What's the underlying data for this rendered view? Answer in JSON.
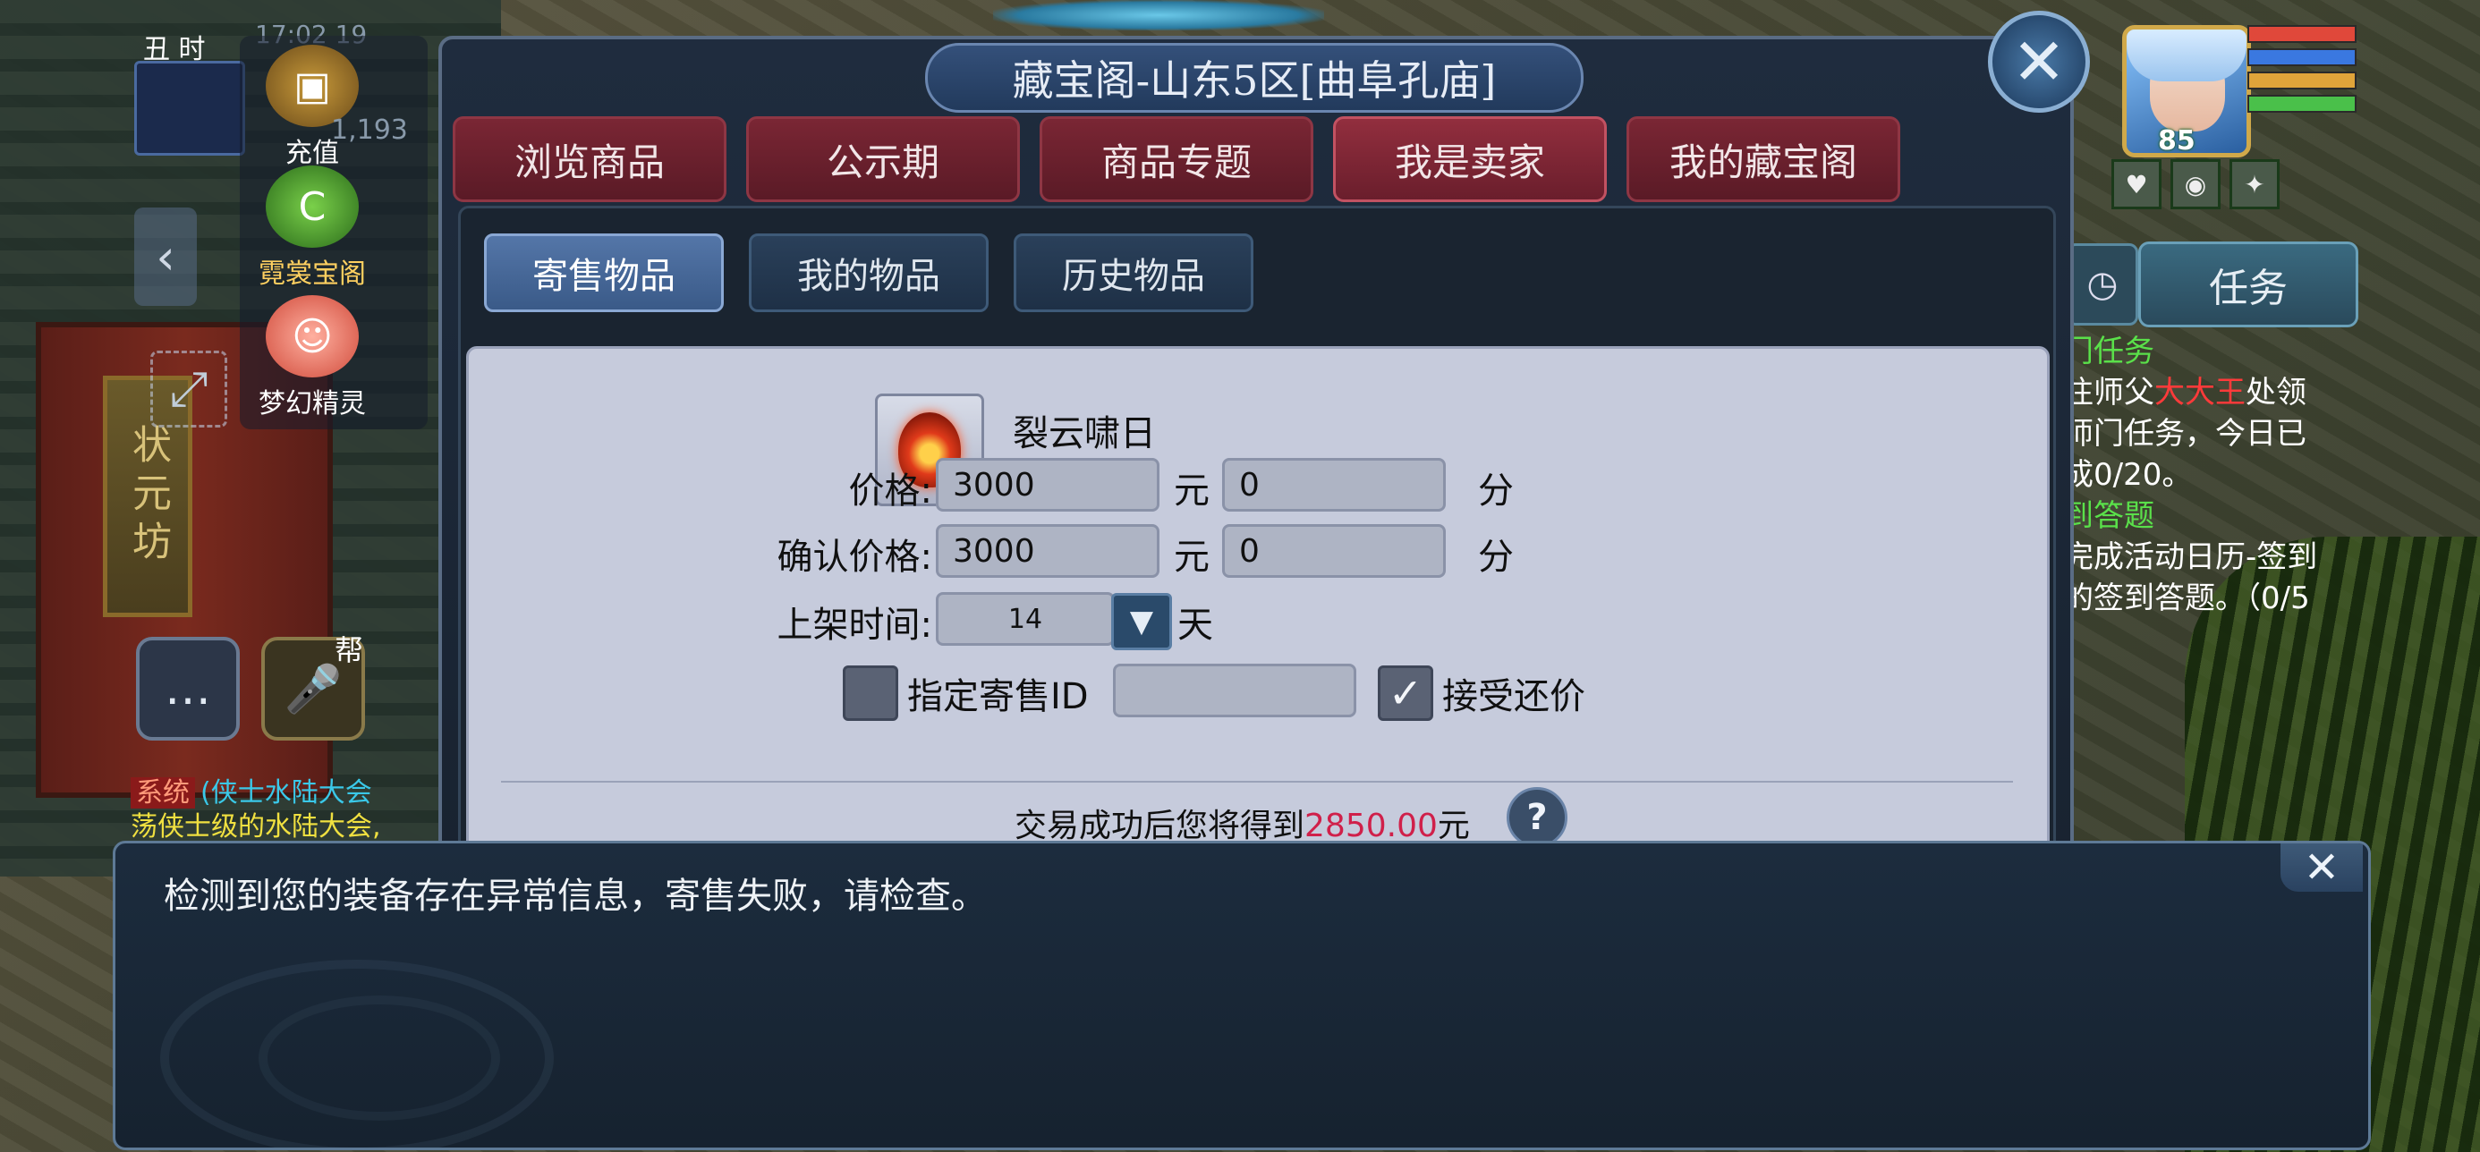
{
  "hud": {
    "time_label": "丑 时",
    "hud_info": "17:02 19",
    "hud_number": "1,193",
    "menu": [
      {
        "label": "充值"
      },
      {
        "label": "霓裳宝阁"
      },
      {
        "label": "梦幻精灵"
      }
    ],
    "bang_label": "帮",
    "system_tag": "系统",
    "system_msg_1": "(侠士水陆大会",
    "system_msg_2": "荡侠士级的水陆大会,"
  },
  "player": {
    "level": "85"
  },
  "task_panel": {
    "tab_label": "任务",
    "quest1_title": "门任务",
    "quest1_text_a": "往师父",
    "quest1_npc": "大大王",
    "quest1_text_b": "处领",
    "quest1_text_c": "师门任务，今日已",
    "quest1_text_d": "成0/20。",
    "quest2_title": "到答题",
    "quest2_text_a": "完成活动日历-签到",
    "quest2_text_b": "的签到答题。（0/5"
  },
  "dialog": {
    "title": "藏宝阁-山东5区[曲阜孔庙]",
    "top_tabs": [
      {
        "label": "浏览商品"
      },
      {
        "label": "公示期"
      },
      {
        "label": "商品专题"
      },
      {
        "label": "我是卖家"
      },
      {
        "label": "我的藏宝阁"
      }
    ],
    "sub_tabs": [
      {
        "label": "寄售物品"
      },
      {
        "label": "我的物品"
      },
      {
        "label": "历史物品"
      }
    ],
    "item_name": "裂云啸日",
    "price_label": "价格:",
    "price_yuan": "3000",
    "price_fen": "0",
    "confirm_label": "确认价格:",
    "confirm_yuan": "3000",
    "confirm_fen": "0",
    "yuan_unit": "元",
    "fen_unit": "分",
    "duration_label": "上架时间:",
    "duration_value": "14",
    "duration_unit": "天",
    "designate_label": "指定寄售ID",
    "designate_value": "",
    "accept_label": "接受还价",
    "accept_checked": true,
    "earn_prefix": "交易成功后您将得到",
    "earn_amount": "2850.00",
    "earn_suffix": "元",
    "help": "?"
  },
  "popup": {
    "message": "检测到您的装备存在异常信息，寄售失败，请检查。",
    "close_symbol": "✕"
  },
  "colors": {
    "tab_red": "#7a2634",
    "sub_tab_active": "#5476a8",
    "earn_amount": "#d0204a",
    "quest_title": "#5ae04a",
    "hp_bar": "#e0483a",
    "mp_bar": "#3a78e0",
    "exp_bar": "#e0a43a",
    "sp_bar": "#4ac04a"
  },
  "bar_levels": {
    "hp": 1.0,
    "mp": 1.0,
    "exp": 1.0,
    "sp": 1.0
  }
}
